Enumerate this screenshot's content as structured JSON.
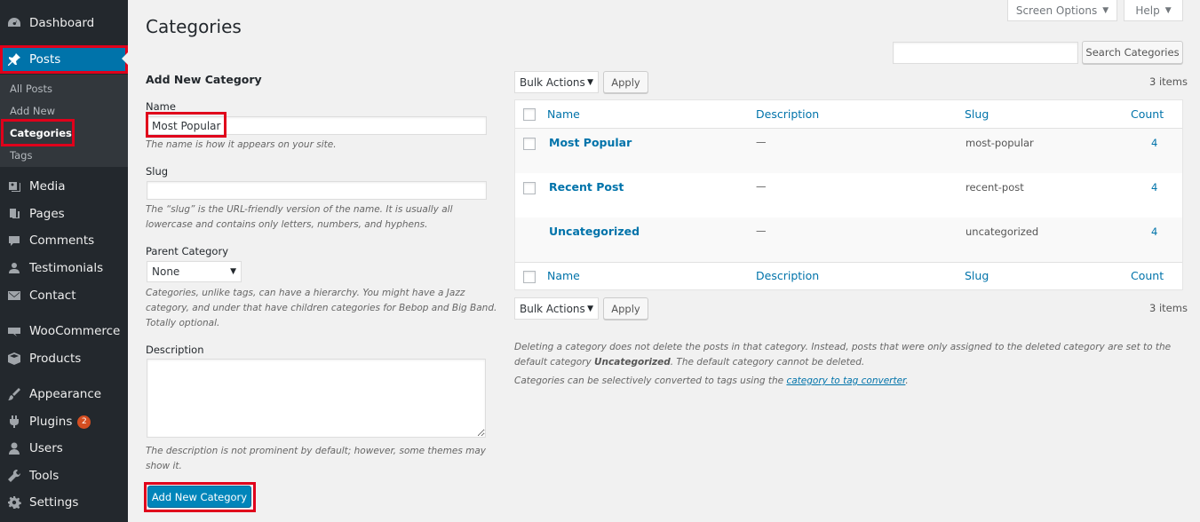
{
  "sidebar": {
    "items": [
      {
        "label": "Dashboard",
        "icon": "dashboard-icon"
      },
      {
        "label": "Posts",
        "icon": "pin-icon"
      },
      {
        "label": "Media",
        "icon": "media-icon"
      },
      {
        "label": "Pages",
        "icon": "pages-icon"
      },
      {
        "label": "Comments",
        "icon": "comments-icon"
      },
      {
        "label": "Testimonials",
        "icon": "users-icon"
      },
      {
        "label": "Contact",
        "icon": "envelope-icon"
      },
      {
        "label": "WooCommerce",
        "icon": "woocommerce-icon"
      },
      {
        "label": "Products",
        "icon": "products-icon"
      },
      {
        "label": "Appearance",
        "icon": "appearance-icon"
      },
      {
        "label": "Plugins",
        "icon": "plugins-icon",
        "badge": "2"
      },
      {
        "label": "Users",
        "icon": "user-icon"
      },
      {
        "label": "Tools",
        "icon": "wrench-icon"
      },
      {
        "label": "Settings",
        "icon": "settings-icon"
      }
    ],
    "submenu": [
      "All Posts",
      "Add New",
      "Categories",
      "Tags"
    ]
  },
  "header": {
    "title": "Categories",
    "screen_options": "Screen Options",
    "help": "Help"
  },
  "search": {
    "value": "",
    "button": "Search Categories"
  },
  "form": {
    "heading": "Add New Category",
    "name_label": "Name",
    "name_value": "Most Popular",
    "name_hint": "The name is how it appears on your site.",
    "slug_label": "Slug",
    "slug_value": "",
    "slug_hint": "The “slug” is the URL-friendly version of the name. It is usually all lowercase and contains only letters, numbers, and hyphens.",
    "parent_label": "Parent Category",
    "parent_value": "None",
    "parent_hint": "Categories, unlike tags, can have a hierarchy. You might have a Jazz category, and under that have children categories for Bebop and Big Band. Totally optional.",
    "description_label": "Description",
    "description_value": "",
    "description_hint": "The description is not prominent by default; however, some themes may show it.",
    "submit": "Add New Category"
  },
  "table": {
    "bulk_actions": "Bulk Actions",
    "apply": "Apply",
    "items_count": "3 items",
    "columns": [
      "Name",
      "Description",
      "Slug",
      "Count"
    ],
    "rows": [
      {
        "name": "Most Popular",
        "description": "—",
        "slug": "most-popular",
        "count": "4"
      },
      {
        "name": "Recent Post",
        "description": "—",
        "slug": "recent-post",
        "count": "4"
      },
      {
        "name": "Uncategorized",
        "description": "—",
        "slug": "uncategorized",
        "count": "4"
      }
    ]
  },
  "notes": {
    "line1_a": "Deleting a category does not delete the posts in that category. Instead, posts that were only assigned to the deleted category are set to the default category ",
    "line1_bold": "Uncategorized",
    "line1_b": ". The default category cannot be deleted.",
    "line2_a": "Categories can be selectively converted to tags using the ",
    "line2_link": "category to tag converter",
    "line2_b": "."
  },
  "colors": {
    "sidebar": "#23282d",
    "accent": "#0073aa",
    "highlight": "#e0001b",
    "badge": "#d54e21"
  }
}
